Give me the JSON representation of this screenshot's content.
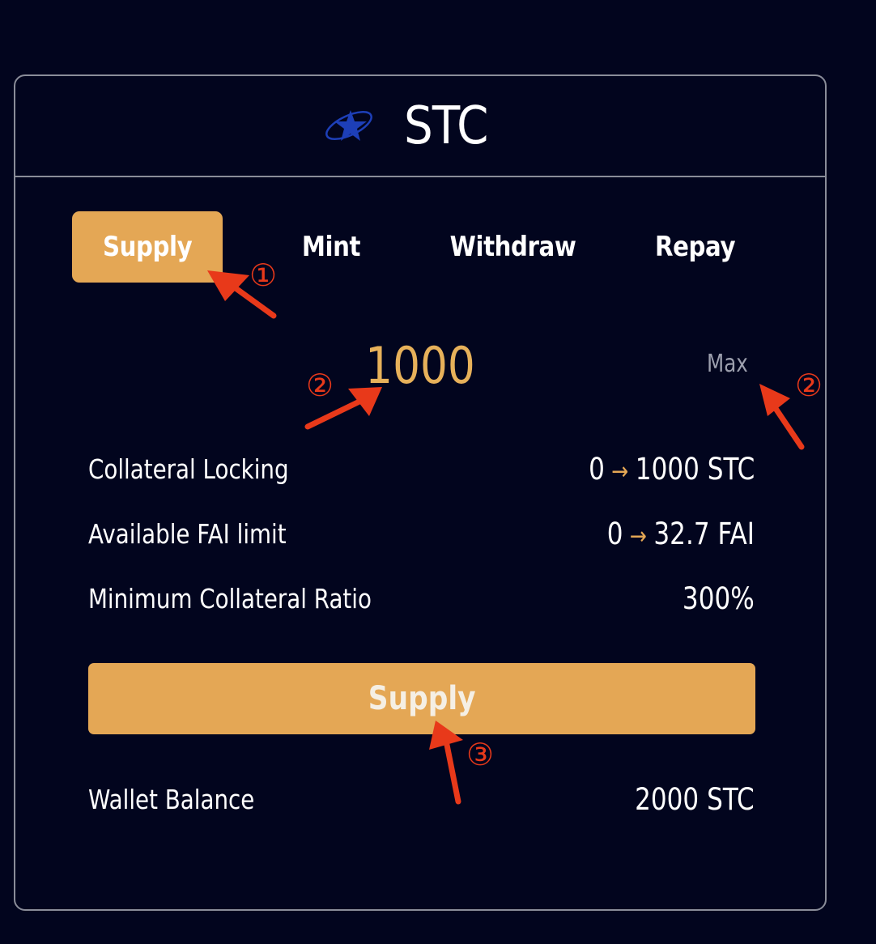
{
  "header": {
    "token_symbol": "STC",
    "logo_icon": "star-orbit-logo-icon"
  },
  "tabs": [
    {
      "label": "Supply",
      "active": true
    },
    {
      "label": "Mint",
      "active": false
    },
    {
      "label": "Withdraw",
      "active": false
    },
    {
      "label": "Repay",
      "active": false
    }
  ],
  "amount": {
    "value": "1000",
    "max_label": "Max"
  },
  "info": {
    "collateral_locking": {
      "label": "Collateral Locking",
      "from": "0",
      "to": "1000 STC"
    },
    "available_fai_limit": {
      "label": "Available FAI limit",
      "from": "0",
      "to": "32.7 FAI"
    },
    "min_collateral_ratio": {
      "label": "Minimum Collateral Ratio",
      "value": "300%"
    }
  },
  "action": {
    "label": "Supply"
  },
  "wallet": {
    "label": "Wallet Balance",
    "value": "2000 STC"
  },
  "annotations": {
    "step1": "①",
    "step2a": "②",
    "step2b": "②",
    "step3": "③"
  },
  "colors": {
    "background": "#02051e",
    "accent": "#e4a755",
    "amount_text": "#e7b15a",
    "border": "#8a8d99",
    "annotation": "#e8391a",
    "logo_blue": "#1d3fb8"
  }
}
